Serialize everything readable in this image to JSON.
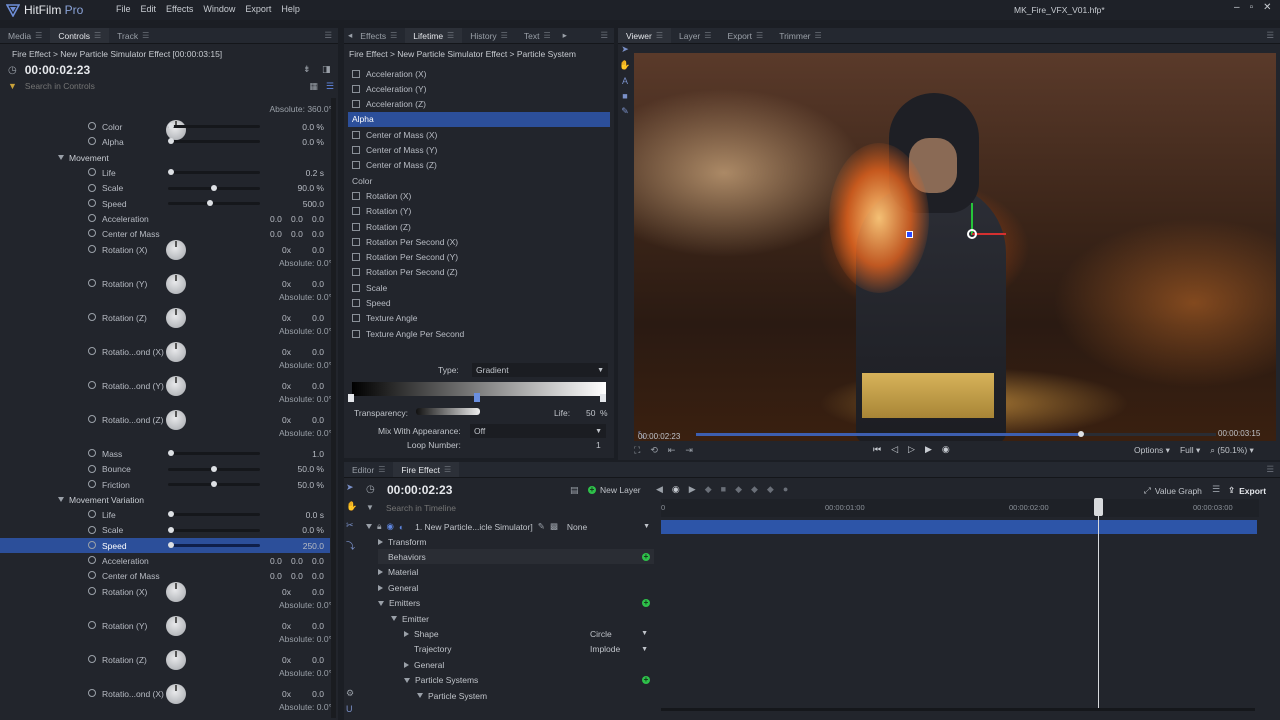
{
  "app": {
    "logo_text": "HitFilm",
    "logo_suffix": "Pro",
    "window_title": "MK_Fire_VFX_V01.hfp*",
    "menu": [
      "File",
      "Edit",
      "Effects",
      "Window",
      "Export",
      "Help"
    ]
  },
  "left_panel": {
    "tabs": [
      "Media",
      "Controls",
      "Track"
    ],
    "active_tab": "Controls",
    "breadcrumb": "Fire Effect > New Particle Simulator Effect [00:00:03:15]",
    "timecode": "00:00:02:23",
    "search_placeholder": "Search in Controls",
    "top_absolute": "Absolute: 360.0°",
    "rows_top": [
      {
        "label": "Color",
        "value": "0.0 %",
        "knob": 0.0
      },
      {
        "label": "Alpha",
        "value": "0.0 %",
        "knob": 0.0
      }
    ],
    "movement": {
      "title": "Movement",
      "rows": [
        {
          "label": "Life",
          "value": "0.2 s",
          "knob": 0.0
        },
        {
          "label": "Scale",
          "value": "90.0 %",
          "knob": 0.5
        },
        {
          "label": "Speed",
          "value": "500.0",
          "knob": 0.45
        }
      ],
      "acceleration": {
        "label": "Acceleration",
        "v1": "0.0",
        "v2": "0.0",
        "v3": "0.0"
      },
      "center_of_mass": {
        "label": "Center of Mass",
        "v1": "0.0",
        "v2": "0.0",
        "v3": "0.0"
      },
      "dials": [
        {
          "label": "Rotation (X)",
          "turns": "0x",
          "value": "0.0",
          "absolute": "Absolute: 0.0°"
        },
        {
          "label": "Rotation (Y)",
          "turns": "0x",
          "value": "0.0",
          "absolute": "Absolute: 0.0°"
        },
        {
          "label": "Rotation (Z)",
          "turns": "0x",
          "value": "0.0",
          "absolute": "Absolute: 0.0°"
        },
        {
          "label": "Rotatio...ond (X)",
          "turns": "0x",
          "value": "0.0",
          "absolute": "Absolute: 0.0°"
        },
        {
          "label": "Rotatio...ond (Y)",
          "turns": "0x",
          "value": "0.0",
          "absolute": "Absolute: 0.0°"
        },
        {
          "label": "Rotatio...ond (Z)",
          "turns": "0x",
          "value": "0.0",
          "absolute": "Absolute: 0.0°"
        }
      ],
      "rows_bottom": [
        {
          "label": "Mass",
          "value": "1.0",
          "knob": 0.0
        },
        {
          "label": "Bounce",
          "value": "50.0 %",
          "knob": 0.5
        },
        {
          "label": "Friction",
          "value": "50.0 %",
          "knob": 0.5
        }
      ]
    },
    "movement_variation": {
      "title": "Movement Variation",
      "rows": [
        {
          "label": "Life",
          "value": "0.0 s",
          "knob": 0.0
        },
        {
          "label": "Scale",
          "value": "0.0 %",
          "knob": 0.0
        },
        {
          "label": "Speed",
          "value": "250.0",
          "knob": 0.0,
          "selected": true
        }
      ],
      "acceleration": {
        "label": "Acceleration",
        "v1": "0.0",
        "v2": "0.0",
        "v3": "0.0"
      },
      "center_of_mass": {
        "label": "Center of Mass",
        "v1": "0.0",
        "v2": "0.0",
        "v3": "0.0"
      },
      "dials": [
        {
          "label": "Rotation (X)",
          "turns": "0x",
          "value": "0.0",
          "absolute": "Absolute: 0.0°"
        },
        {
          "label": "Rotation (Y)",
          "turns": "0x",
          "value": "0.0",
          "absolute": "Absolute: 0.0°"
        },
        {
          "label": "Rotation (Z)",
          "turns": "0x",
          "value": "0.0",
          "absolute": "Absolute: 0.0°"
        },
        {
          "label": "Rotatio...ond (X)",
          "turns": "0x",
          "value": "0.0",
          "absolute": "Absolute: 0.0°"
        }
      ]
    }
  },
  "lifetime_panel": {
    "tabs": [
      "Effects",
      "Lifetime",
      "History",
      "Text"
    ],
    "active_tab": "Lifetime",
    "breadcrumb": "Fire Effect > New Particle Simulator Effect > Particle System",
    "items": [
      {
        "label": "Acceleration (X)",
        "checkbox": true
      },
      {
        "label": "Acceleration (Y)",
        "checkbox": true
      },
      {
        "label": "Acceleration (Z)",
        "checkbox": true
      },
      {
        "label": "Alpha",
        "checkbox": false,
        "selected": true
      },
      {
        "label": "Center of Mass (X)",
        "checkbox": true
      },
      {
        "label": "Center of Mass (Y)",
        "checkbox": true
      },
      {
        "label": "Center of Mass (Z)",
        "checkbox": true
      },
      {
        "label": "Color",
        "checkbox": false
      },
      {
        "label": "Rotation (X)",
        "checkbox": true
      },
      {
        "label": "Rotation (Y)",
        "checkbox": true
      },
      {
        "label": "Rotation (Z)",
        "checkbox": true
      },
      {
        "label": "Rotation Per Second (X)",
        "checkbox": true
      },
      {
        "label": "Rotation Per Second (Y)",
        "checkbox": true
      },
      {
        "label": "Rotation Per Second (Z)",
        "checkbox": true
      },
      {
        "label": "Scale",
        "checkbox": true
      },
      {
        "label": "Speed",
        "checkbox": true
      },
      {
        "label": "Texture Angle",
        "checkbox": true
      },
      {
        "label": "Texture Angle Per Second",
        "checkbox": true
      }
    ],
    "type_label": "Type:",
    "type_value": "Gradient",
    "transparency_label": "Transparency:",
    "life_label": "Life:",
    "life_value": "50",
    "life_unit": "%",
    "mix_label": "Mix With Appearance:",
    "mix_value": "Off",
    "loop_label": "Loop Number:",
    "loop_value": "1"
  },
  "viewer_panel": {
    "tabs": [
      "Viewer",
      "Layer",
      "Export",
      "Trimmer"
    ],
    "active_tab": "Viewer",
    "current_time": "00:00:02:23",
    "end_time": "00:00:03:15",
    "scrub_progress": 0.74,
    "options_label": "Options",
    "quality_label": "Full",
    "zoom_label": "(50.1%)"
  },
  "editor_panel": {
    "tabs": [
      "Editor",
      "Fire Effect"
    ],
    "active_tab": "Fire Effect",
    "timecode": "00:00:02:23",
    "new_layer_label": "New Layer",
    "value_graph_label": "Value Graph",
    "export_label": "Export",
    "search_placeholder": "Search in Timeline",
    "ruler": [
      "0",
      "00:00:01:00",
      "00:00:02:00",
      "00:00:03:00"
    ],
    "layer_name": "1. New Particle...icle Simulator]",
    "blend": "None",
    "tree": [
      {
        "label": "Transform",
        "indent": 0,
        "open": false,
        "plus": false
      },
      {
        "label": "Behaviors",
        "indent": 0,
        "open": null,
        "plus": true,
        "highlight": true
      },
      {
        "label": "Material",
        "indent": 0,
        "open": false,
        "plus": false
      },
      {
        "label": "General",
        "indent": 0,
        "open": false,
        "plus": false
      },
      {
        "label": "Emitters",
        "indent": 0,
        "open": true,
        "plus": true
      },
      {
        "label": "Emitter",
        "indent": 1,
        "open": true,
        "plus": false
      },
      {
        "label": "Shape",
        "indent": 2,
        "open": false,
        "plus": false,
        "value": "Circle"
      },
      {
        "label": "Trajectory",
        "indent": 2,
        "open": null,
        "plus": false,
        "value": "Implode"
      },
      {
        "label": "General",
        "indent": 2,
        "open": false,
        "plus": false
      },
      {
        "label": "Particle Systems",
        "indent": 2,
        "open": true,
        "plus": true
      },
      {
        "label": "Particle System",
        "indent": 3,
        "open": true,
        "plus": false
      }
    ]
  },
  "colors": {
    "accent": "#2c4f9a",
    "track": "#2d55a8",
    "add": "#2ec14a"
  }
}
